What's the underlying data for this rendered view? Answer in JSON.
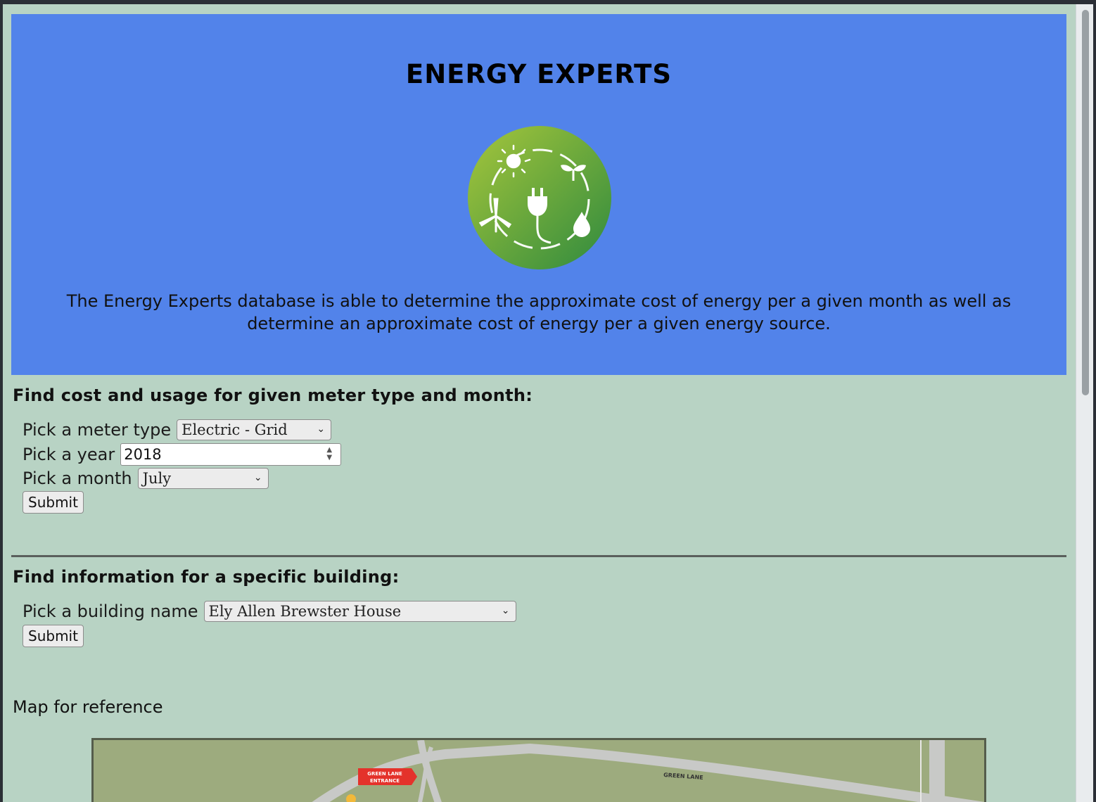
{
  "hero": {
    "title": "ENERGY EXPERTS",
    "logo_icon": "renewable-energy-logo-icon",
    "description": "The Energy Experts database is able to determine the approximate cost of energy per a given month as well as determine an approximate cost of energy per a given energy source."
  },
  "meter_form": {
    "title": "Find cost and usage for given meter type and month:",
    "meter_label": "Pick a meter type",
    "meter_value": "Electric - Grid",
    "year_label": "Pick a year",
    "year_value": "2018",
    "month_label": "Pick a month",
    "month_value": "July",
    "submit_label": "Submit"
  },
  "building_form": {
    "title": "Find information for a specific building:",
    "building_label": "Pick a building name",
    "building_value": "Ely Allen Brewster House",
    "submit_label": "Submit"
  },
  "map": {
    "caption": "Map for reference",
    "entrance_label_line1": "GREEN LANE",
    "entrance_label_line2": "ENTRANCE",
    "road_label": "GREEN LANE"
  },
  "colors": {
    "hero_bg": "#5283ea",
    "page_bg": "#b8d3c4",
    "logo_green": "#5fa83a",
    "map_bg": "#9dab7e"
  }
}
